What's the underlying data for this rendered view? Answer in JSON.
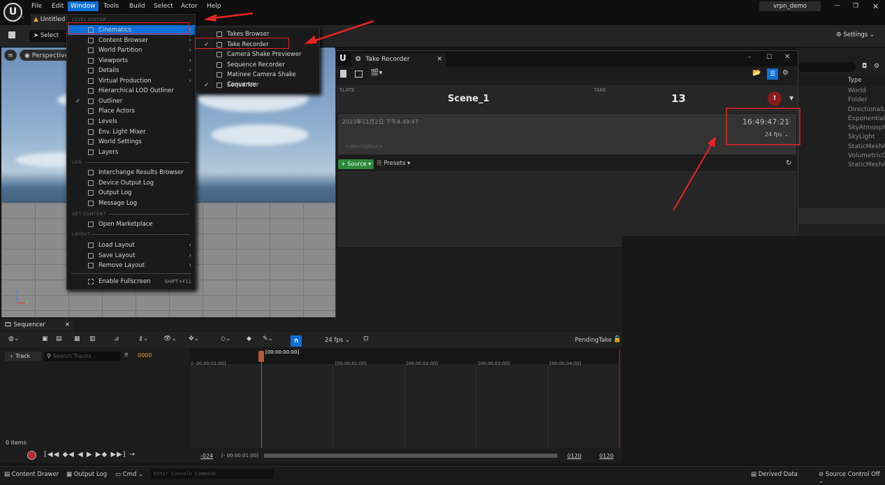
{
  "menubar": {
    "items": [
      "File",
      "Edit",
      "Window",
      "Tools",
      "Build",
      "Select",
      "Actor",
      "Help"
    ],
    "project": "vrpn_demo",
    "level_tab": "Untitled"
  },
  "toolbar": {
    "select_label": "Select",
    "settings_label": "Settings"
  },
  "viewport": {
    "menu_icon": "hamburger-icon",
    "perspective_label": "Perspective"
  },
  "window_menu": {
    "section_level_editor": "LEVEL EDITOR",
    "items_level": [
      {
        "label": "Cinematics",
        "arrow": true,
        "selected": true
      },
      {
        "label": "Content Browser",
        "arrow": true
      },
      {
        "label": "World Partition",
        "arrow": true
      },
      {
        "label": "Viewports",
        "arrow": true
      },
      {
        "label": "Details",
        "arrow": true
      },
      {
        "label": "Virtual Production",
        "arrow": true
      },
      {
        "label": "Hierarchical LOD Outliner"
      },
      {
        "label": "Outliner",
        "checked": true
      },
      {
        "label": "Place Actors"
      },
      {
        "label": "Levels"
      },
      {
        "label": "Env. Light Mixer"
      },
      {
        "label": "World Settings"
      },
      {
        "label": "Layers"
      }
    ],
    "section_log": "LOG",
    "items_log": [
      "Interchange Results Browser",
      "Device Output Log",
      "Output Log",
      "Message Log"
    ],
    "section_get_content": "GET CONTENT",
    "items_content": [
      "Open Marketplace"
    ],
    "section_layout": "LAYOUT",
    "items_layout": [
      "Load Layout",
      "Save Layout",
      "Remove Layout"
    ],
    "fullscreen_label": "Enable Fullscreen",
    "fullscreen_shortcut": "SHIFT+F11"
  },
  "cinematics_submenu": [
    {
      "label": "Takes Browser"
    },
    {
      "label": "Take Recorder",
      "checked": true
    },
    {
      "label": "Camera Shake Previewer"
    },
    {
      "label": "Sequence Recorder"
    },
    {
      "label": "Matinee Camera Shake Converter"
    },
    {
      "label": "Sequencer",
      "checked": true
    }
  ],
  "take_recorder": {
    "tab_title": "Take Recorder",
    "slate_label": "SLATE",
    "slate_value": "Scene_1",
    "take_label": "TAKE",
    "take_value": "13",
    "date": "2023年11月2日 下午4:49:47",
    "timecode": "16:49:47:21",
    "fps": "24 fps",
    "description_placeholder": "<description>",
    "source_button": "Source",
    "presets_label": "Presets",
    "warning_symbol": "!"
  },
  "outliner": {
    "type_header": "Type",
    "types": [
      "World",
      "Folder",
      "DirectionalLi",
      "ExponentialH",
      "SkyAtmosphe",
      "SkyLight",
      "StaticMeshA",
      "VolumetricCl",
      "StaticMeshA"
    ]
  },
  "sequencer": {
    "tab_title": "Sequencer",
    "fps": "24 fps",
    "pending_take": "PendingTake",
    "track_button": "Track",
    "search_placeholder": "Search Tracks",
    "frame_value": "0000",
    "items_count": "0 items",
    "playhead_label": "[00:00:00:00]",
    "ticks": [
      "[- 00:00:01:00]",
      "[00:00:01:00]",
      "[00:00:02:00]",
      "[00:00:03:00]",
      "[00:00:04:00]"
    ],
    "range_start": "-024",
    "range_start_tc": "[- 00:00:01:00]",
    "range_end_a": "0120",
    "range_end_b": "0120"
  },
  "statusbar": {
    "content_drawer": "Content Drawer",
    "output_log": "Output Log",
    "cmd_label": "Cmd",
    "console_placeholder": "Enter Console Command",
    "derived_data": "Derived Data",
    "source_control": "Source Control Off"
  },
  "colors": {
    "accent": "#0e6fd6",
    "highlight_red": "#e22222",
    "source_green": "#2c8a3a"
  }
}
